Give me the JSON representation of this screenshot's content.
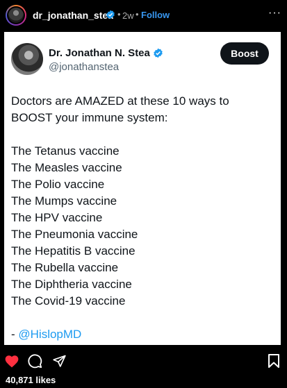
{
  "ig_post": {
    "username": "dr_jonathan_stea",
    "time": "2w",
    "separator": "•",
    "follow_label": "Follow",
    "more_label": "···",
    "likes": "40,871 likes"
  },
  "tweet": {
    "name": "Dr. Jonathan N. Stea",
    "handle": "@jonathanstea",
    "boost_label": "Boost",
    "intro": [
      "Doctors are AMAZED at these 10 ways to",
      "BOOST your immune system:"
    ],
    "items": [
      "The Tetanus vaccine",
      "The Measles vaccine",
      "The Polio vaccine",
      "The Mumps vaccine",
      "The HPV vaccine",
      "The Pneumonia vaccine",
      "The Hepatitis B vaccine",
      "The Rubella vaccine",
      "The Diphtheria vaccine",
      "The Covid-19 vaccine"
    ],
    "signoff_prefix": "- ",
    "signoff_mention": "@HislopMD"
  },
  "colors": {
    "follow": "#3897f0",
    "verified": "#1d9bf0",
    "like": "#ff3040",
    "mention": "#1d9bf0"
  },
  "icons": {
    "like": "heart-icon",
    "comment": "comment-icon",
    "share": "send-icon",
    "save": "bookmark-icon"
  }
}
